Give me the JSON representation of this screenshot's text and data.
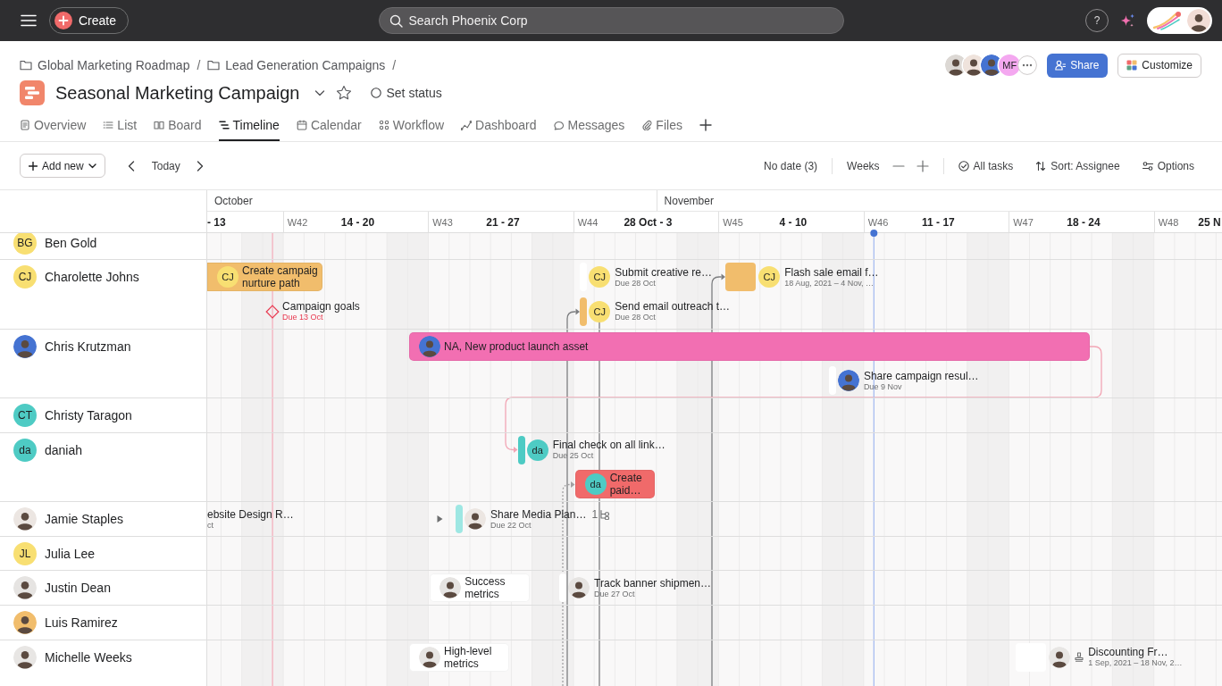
{
  "topbar": {
    "create_label": "Create",
    "search_placeholder": "Search Phoenix Corp",
    "help_label": "?",
    "profile_avatar": {
      "kind": "photo",
      "color": "#f2ddd6"
    }
  },
  "breadcrumbs": [
    {
      "label": "Global Marketing Roadmap",
      "separator": "/"
    },
    {
      "label": "Lead Generation Campaigns",
      "separator": "/"
    }
  ],
  "project": {
    "title": "Seasonal Marketing Campaign",
    "starred": false,
    "status_label": "Set status"
  },
  "members": [
    {
      "kind": "photo",
      "color": "#dcd8d4"
    },
    {
      "kind": "photo",
      "color": "#efe3dc"
    },
    {
      "kind": "photo",
      "color": "#4573d2"
    },
    {
      "kind": "initials",
      "initials": "MF",
      "color": "#f4a8f0"
    }
  ],
  "share_label": "Share",
  "customize_label": "Customize",
  "tabs": [
    {
      "kind": "overview",
      "label": "Overview",
      "selected": false
    },
    {
      "kind": "list",
      "label": "List",
      "selected": false
    },
    {
      "kind": "board",
      "label": "Board",
      "selected": false
    },
    {
      "kind": "timeline",
      "label": "Timeline",
      "selected": true
    },
    {
      "kind": "calendar",
      "label": "Calendar",
      "selected": false
    },
    {
      "kind": "workflow",
      "label": "Workflow",
      "selected": false
    },
    {
      "kind": "dashboard",
      "label": "Dashboard",
      "selected": false
    },
    {
      "kind": "messages",
      "label": "Messages",
      "selected": false
    },
    {
      "kind": "files",
      "label": "Files",
      "selected": false
    }
  ],
  "toolbar": {
    "add_label": "Add new",
    "today_label": "Today",
    "no_date_label": "No date (3)",
    "zoom_label": "Weeks",
    "filter_label": "All tasks",
    "sort_label": "Sort: Assignee",
    "options_label": "Options"
  },
  "timeline": {
    "months": [
      {
        "label": "October"
      },
      {
        "label": "November"
      }
    ],
    "weeks": [
      {
        "range": "- 13"
      },
      {
        "number": "W42",
        "range": "14 - 20"
      },
      {
        "number": "W43",
        "range": "21 - 27"
      },
      {
        "number": "W44",
        "range": "28 Oct - 3"
      },
      {
        "number": "W45",
        "range": "4 - 10"
      },
      {
        "number": "W46",
        "range": "11 - 17"
      },
      {
        "number": "W47",
        "range": "18 - 24"
      },
      {
        "number": "W48",
        "range": "25 N"
      }
    ],
    "rows": [
      {
        "name": "Ben Gold",
        "avatar": {
          "kind": "initials",
          "initials": "BG",
          "color": "#f8df72"
        }
      },
      {
        "name": "Charolette Johns",
        "avatar": {
          "kind": "initials",
          "initials": "CJ",
          "color": "#f8df72"
        },
        "lanes": [
          [
            {
              "kind": "bar",
              "title": "Create campaig\nnurture path",
              "color": "#f1bd6c",
              "assignee": {
                "kind": "initials",
                "initials": "CJ",
                "color": "#f8df72"
              }
            },
            {
              "kind": "pill",
              "title": "Submit creative re…",
              "due": "Due 28 Oct",
              "overdue": false,
              "color": "#ffffff",
              "assignee": {
                "kind": "initials",
                "initials": "CJ",
                "color": "#f8df72"
              }
            },
            {
              "kind": "block",
              "title": "Flash sale email f…",
              "dates": "18 Aug, 2021 – 4 Nov, …",
              "color": "#f1bd6c",
              "assignee": {
                "kind": "initials",
                "initials": "CJ",
                "color": "#f8df72"
              }
            }
          ],
          [
            {
              "kind": "milestone",
              "title": "Campaign goals",
              "due": "Due 13 Oct",
              "overdue": true
            },
            {
              "kind": "pill",
              "title": "Send email outreach t…",
              "due": "Due 28 Oct",
              "overdue": false,
              "color": "#f1bd6c",
              "assignee": {
                "kind": "initials",
                "initials": "CJ",
                "color": "#f8df72"
              }
            }
          ]
        ]
      },
      {
        "name": "Chris Krutzman",
        "avatar": {
          "kind": "photo",
          "color": "#4573d2"
        },
        "lanes": [
          [
            {
              "kind": "bar",
              "title": "NA, New product launch asset",
              "color": "#f26fb2",
              "assignee": {
                "kind": "photo",
                "color": "#4573d2"
              }
            }
          ],
          [
            {
              "kind": "pill",
              "title": "Share campaign resul…",
              "due": "Due 9 Nov",
              "overdue": false,
              "color": "#ffffff",
              "assignee": {
                "kind": "photo",
                "color": "#4573d2"
              }
            }
          ]
        ]
      },
      {
        "name": "Christy Taragon",
        "avatar": {
          "kind": "initials",
          "initials": "CT",
          "color": "#4ecbc4"
        }
      },
      {
        "name": "daniah",
        "avatar": {
          "kind": "initials",
          "initials": "da",
          "color": "#4ecbc4"
        },
        "lanes": [
          [
            {
              "kind": "pill",
              "title": "Final check on all link…",
              "due": "Due 25 Oct",
              "overdue": false,
              "color": "#4ecbc4",
              "assignee": {
                "kind": "initials",
                "initials": "da",
                "color": "#4ecbc4"
              }
            }
          ],
          [
            {
              "kind": "bar",
              "title": "Create\npaid…",
              "color": "#f06a6a",
              "assignee": {
                "kind": "initials",
                "initials": "da",
                "color": "#4ecbc4"
              }
            }
          ]
        ]
      },
      {
        "name": "Jamie Staples",
        "avatar": {
          "kind": "photo",
          "color": "#ece6e2"
        },
        "lanes": [
          [
            {
              "kind": "offscreen",
              "title": "ebsite Design R…",
              "due": "ct",
              "overdue": false
            },
            {
              "kind": "pill",
              "title": "Share Media Plan…",
              "due": "Due 22 Oct",
              "overdue": false,
              "color": "#9ee7e3",
              "expanded": false,
              "subtask_count": "1",
              "assignee": {
                "kind": "photo",
                "color": "#ece6e2"
              }
            }
          ]
        ]
      },
      {
        "name": "Julia Lee",
        "avatar": {
          "kind": "initials",
          "initials": "JL",
          "color": "#f8df72"
        }
      },
      {
        "name": "Justin Dean",
        "avatar": {
          "kind": "photo",
          "color": "#e6e4e2"
        },
        "lanes": [
          [
            {
              "kind": "bar",
              "title": "Success metrics",
              "color": "#ffffff",
              "assignee": {
                "kind": "photo",
                "color": "#e6e4e2"
              }
            },
            {
              "kind": "pill",
              "title": "Track banner shipmen…",
              "due": "Due 27 Oct",
              "overdue": false,
              "color": "#ffffff",
              "assignee": {
                "kind": "photo",
                "color": "#e6e4e2"
              }
            }
          ]
        ]
      },
      {
        "name": "Luis Ramirez",
        "avatar": {
          "kind": "photo",
          "color": "#f1bd6c"
        }
      },
      {
        "name": "Michelle Weeks",
        "avatar": {
          "kind": "photo",
          "color": "#e8e6e4"
        },
        "lanes": [
          [
            {
              "kind": "bar",
              "title": "High-level metrics",
              "color": "#ffffff",
              "assignee": {
                "kind": "photo",
                "color": "#e8e6e4"
              }
            },
            {
              "kind": "block",
              "title": "Discounting Fr…",
              "dates": "1 Sep, 2021 – 18 Nov, 2…",
              "color": "#ffffff",
              "approval": true,
              "assignee": {
                "kind": "photo",
                "color": "#e8e6e4"
              }
            }
          ]
        ]
      }
    ]
  }
}
